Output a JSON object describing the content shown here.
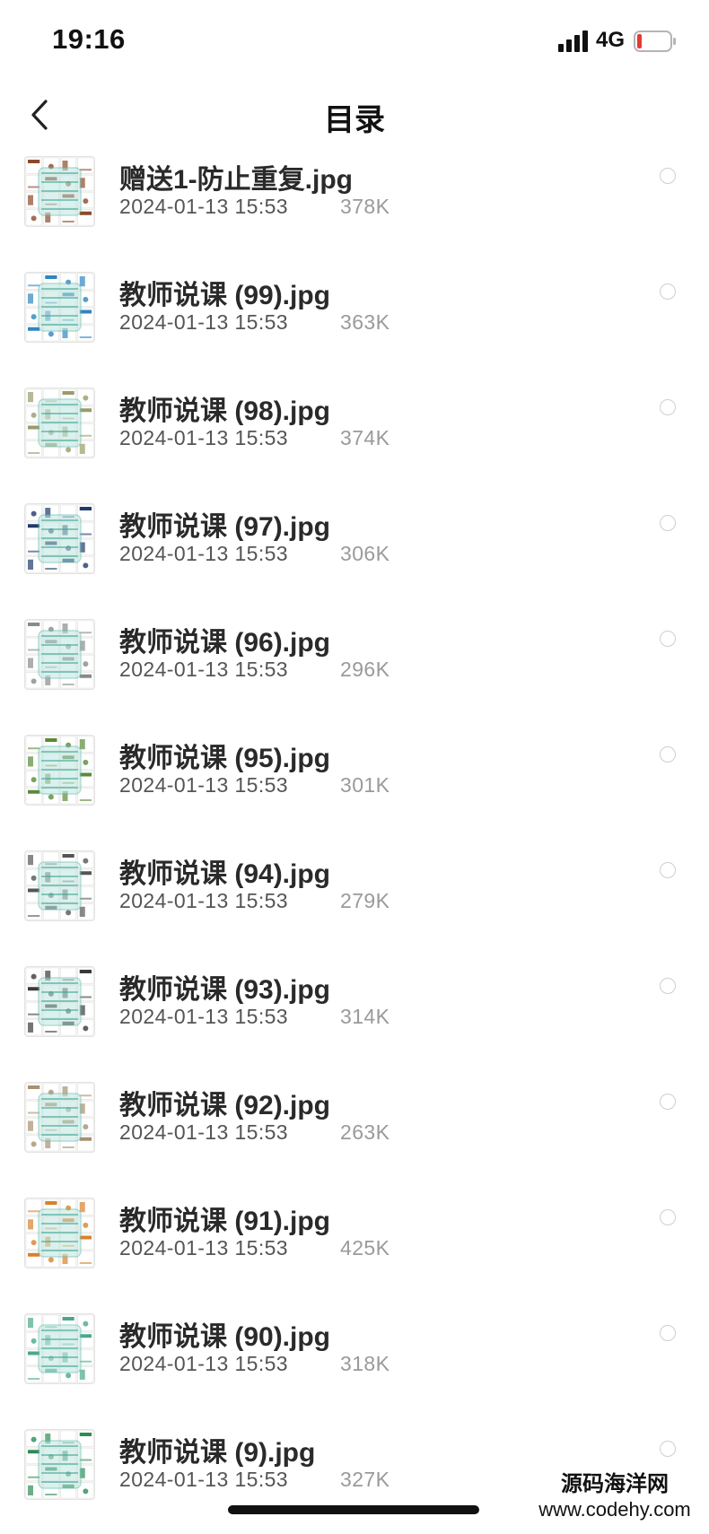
{
  "status": {
    "time": "19:16",
    "network": "4G",
    "battery_color": "#e53935"
  },
  "nav": {
    "title": "目录",
    "back_icon": "chevron-left-icon"
  },
  "files": [
    {
      "name": "赠送1-防止重复.jpg",
      "date": "2024-01-13 15:53",
      "size": "378K",
      "thumb_theme": "#8b4a2b"
    },
    {
      "name": "教师说课 (99).jpg",
      "date": "2024-01-13 15:53",
      "size": "363K",
      "thumb_theme": "#2e86c1"
    },
    {
      "name": "教师说课 (98).jpg",
      "date": "2024-01-13 15:53",
      "size": "374K",
      "thumb_theme": "#9a9a6a"
    },
    {
      "name": "教师说课 (97).jpg",
      "date": "2024-01-13 15:53",
      "size": "306K",
      "thumb_theme": "#1f3a6b"
    },
    {
      "name": "教师说课 (96).jpg",
      "date": "2024-01-13 15:53",
      "size": "296K",
      "thumb_theme": "#8a8a8a"
    },
    {
      "name": "教师说课 (95).jpg",
      "date": "2024-01-13 15:53",
      "size": "301K",
      "thumb_theme": "#5a8a3a"
    },
    {
      "name": "教师说课 (94).jpg",
      "date": "2024-01-13 15:53",
      "size": "279K",
      "thumb_theme": "#555555"
    },
    {
      "name": "教师说课 (93).jpg",
      "date": "2024-01-13 15:53",
      "size": "314K",
      "thumb_theme": "#3a3a3a"
    },
    {
      "name": "教师说课 (92).jpg",
      "date": "2024-01-13 15:53",
      "size": "263K",
      "thumb_theme": "#a89070"
    },
    {
      "name": "教师说课 (91).jpg",
      "date": "2024-01-13 15:53",
      "size": "425K",
      "thumb_theme": "#d9822b"
    },
    {
      "name": "教师说课 (90).jpg",
      "date": "2024-01-13 15:53",
      "size": "318K",
      "thumb_theme": "#4aa88a"
    },
    {
      "name": "教师说课 (9).jpg",
      "date": "2024-01-13 15:53",
      "size": "327K",
      "thumb_theme": "#2e8b57"
    }
  ],
  "watermark": {
    "cn": "源码海洋网",
    "url": "www.codehy.com"
  }
}
